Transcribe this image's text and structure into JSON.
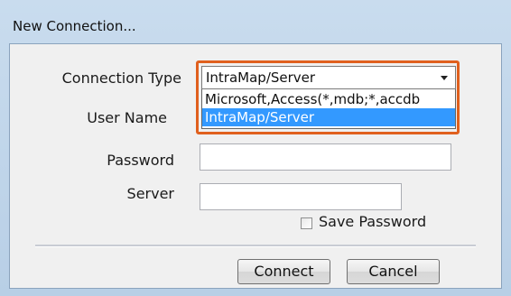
{
  "window": {
    "title": "New Connection..."
  },
  "form": {
    "connection_type_label": "Connection Type",
    "user_name_label": "User Name",
    "password_label": "Password",
    "server_label": "Server",
    "password_value": "",
    "server_value": ""
  },
  "connection_type": {
    "selected": "IntraMap/Server",
    "options": [
      "Microsoft,Access(*,mdb;*,accdb",
      "IntraMap/Server"
    ],
    "highlighted_option": "IntraMap/Server"
  },
  "save_password": {
    "label": "Save Password",
    "checked": false
  },
  "buttons": {
    "connect_label": "Connect",
    "cancel_label": "Cancel"
  },
  "colors": {
    "highlight_outline": "#e0601e",
    "selection": "#3399ff"
  }
}
